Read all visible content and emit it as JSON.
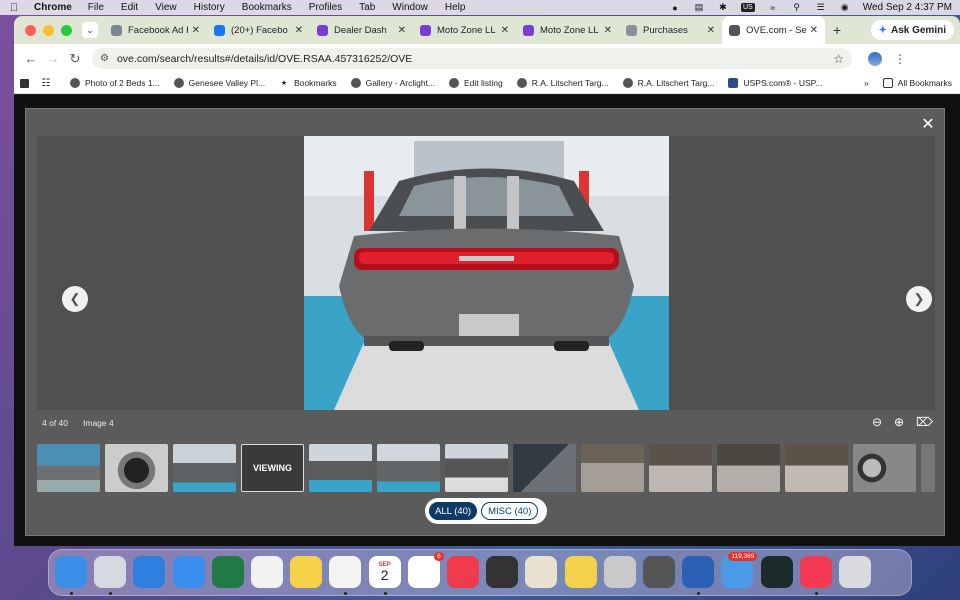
{
  "menubar": {
    "app_name": "Chrome",
    "items": [
      "File",
      "Edit",
      "View",
      "History",
      "Bookmarks",
      "Profiles",
      "Tab",
      "Window",
      "Help"
    ],
    "input_source": "US",
    "clock": "Wed Sep 2  4:37 PM"
  },
  "tabs": [
    {
      "title": "Facebook Ad R",
      "favicon_color": "#7b8592",
      "favicon": "globe-icon"
    },
    {
      "title": "(20+) Facebo",
      "favicon_color": "#1877f2",
      "favicon": "facebook-icon"
    },
    {
      "title": "Dealer Dash",
      "favicon_color": "#7a3fd1",
      "favicon": "dealer-icon"
    },
    {
      "title": "Moto Zone LL",
      "favicon_color": "#7a3fd1",
      "favicon": "dealer-icon"
    },
    {
      "title": "Moto Zone LL",
      "favicon_color": "#7a3fd1",
      "favicon": "dealer-icon"
    },
    {
      "title": "Purchases",
      "favicon_color": "#8a8f99",
      "favicon": "globe-icon"
    },
    {
      "title": "OVE.com - Se",
      "favicon_color": "#555555",
      "favicon": "ove-icon",
      "active": true
    }
  ],
  "gemini_label": "Ask Gemini",
  "address_bar": {
    "url": "ove.com/search/results#/details/id/OVE.RSAA.457316252/OVE"
  },
  "bookmarks": [
    {
      "label": "",
      "icon": "apps-grid-icon"
    },
    {
      "label": "Photo of 2 Beds 1...",
      "icon": "site-icon"
    },
    {
      "label": "Genesee Valley Pl...",
      "icon": "site-icon"
    },
    {
      "label": "Bookmarks",
      "icon": "star-icon"
    },
    {
      "label": "Gallery - Arclight...",
      "icon": "site-icon"
    },
    {
      "label": "Edit listing",
      "icon": "site-icon"
    },
    {
      "label": "R.A. Litschert Targ...",
      "icon": "site-icon"
    },
    {
      "label": "R.A. Litschert Targ...",
      "icon": "site-icon"
    },
    {
      "label": "USPS.com® - USP...",
      "icon": "usps-icon"
    }
  ],
  "all_bookmarks_label": "All Bookmarks",
  "viewer": {
    "counter": "4 of 40",
    "image_label": "Image 4",
    "viewing_label": "VIEWING",
    "thumbnail_count": 13,
    "filters": [
      {
        "label": "ALL (40)",
        "active": true
      },
      {
        "label": "MISC (40)",
        "active": false
      }
    ]
  },
  "dock": [
    {
      "name": "finder",
      "color": "#3b8fe8"
    },
    {
      "name": "launchpad",
      "color": "#d7d9e0"
    },
    {
      "name": "safari",
      "color": "#2d7fe0"
    },
    {
      "name": "app-store",
      "color": "#3a8ef0"
    },
    {
      "name": "excel",
      "color": "#1f7a45"
    },
    {
      "name": "photos",
      "color": "#f2f2f2"
    },
    {
      "name": "notes",
      "color": "#f6d24a"
    },
    {
      "name": "chrome",
      "color": "#f4f4f4"
    },
    {
      "name": "calendar",
      "color": "#ffffff",
      "text": "2",
      "month": "SEP"
    },
    {
      "name": "reminders",
      "color": "#ffffff",
      "badge": "6"
    },
    {
      "name": "news",
      "color": "#f23a4d"
    },
    {
      "name": "calculator",
      "color": "#333333"
    },
    {
      "name": "preview",
      "color": "#e7e2d0"
    },
    {
      "name": "stickies",
      "color": "#f3d14a"
    },
    {
      "name": "whatsapp",
      "color": "#c9c9c9"
    },
    {
      "name": "keychain",
      "color": "#555555"
    },
    {
      "name": "word",
      "color": "#2b5fb4"
    },
    {
      "name": "mail",
      "color": "#4a9ae8",
      "badge": "119,369"
    },
    {
      "name": "activity-monitor",
      "color": "#1a2b2a"
    },
    {
      "name": "music",
      "color": "#f33a52"
    },
    {
      "name": "trash",
      "color": "#d9dbe0"
    }
  ]
}
